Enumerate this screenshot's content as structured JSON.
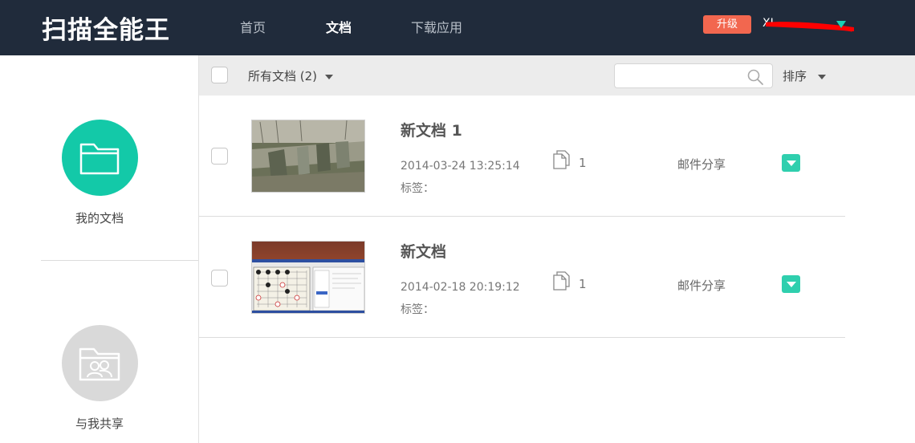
{
  "header": {
    "logo": "扫描全能王",
    "nav": [
      {
        "label": "首页",
        "active": false
      },
      {
        "label": "文档",
        "active": true
      },
      {
        "label": "下载应用",
        "active": false
      }
    ],
    "upgrade_label": "升级",
    "user_name": "XL",
    "accent_color": "#1ccfb4",
    "upgrade_color": "#f2674f",
    "bar_color": "#202b3b"
  },
  "sidebar": {
    "items": [
      {
        "label": "我的文档",
        "icon": "folder-icon",
        "color": "#13c9a8"
      },
      {
        "label": "与我共享",
        "icon": "shared-folder-icon",
        "color": "#d9d9d9"
      }
    ]
  },
  "toolbar": {
    "filter_label": "所有文档 (2)",
    "search_placeholder": "",
    "sort_label": "排序"
  },
  "documents": [
    {
      "title": "新文档 1",
      "date": "2014-03-24 13:25:14",
      "tags_label": "标签：",
      "pages": "1",
      "share_label": "邮件分享"
    },
    {
      "title": "新文档",
      "date": "2014-02-18 20:19:12",
      "tags_label": "标签：",
      "pages": "1",
      "share_label": "邮件分享"
    }
  ]
}
